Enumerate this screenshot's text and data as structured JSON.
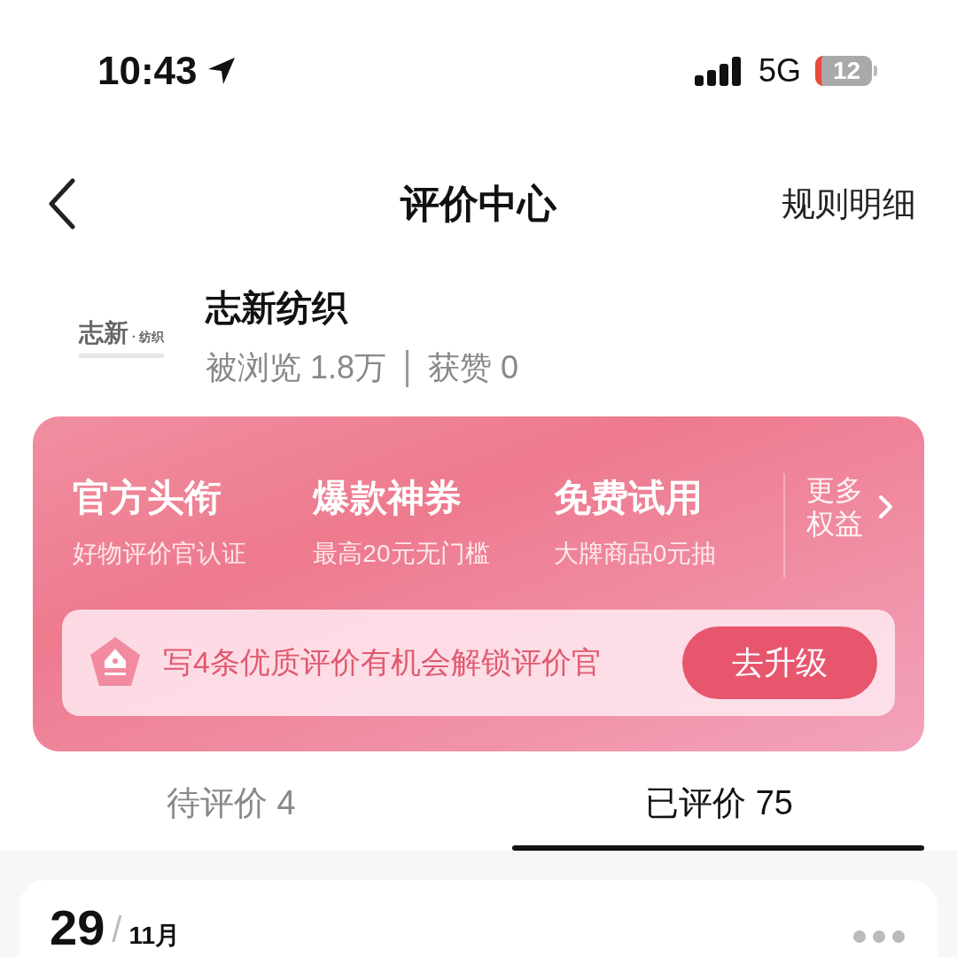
{
  "status_bar": {
    "time": "10:43",
    "network": "5G",
    "battery": "12"
  },
  "nav": {
    "title": "评价中心",
    "action": "规则明细"
  },
  "shop": {
    "logo": {
      "name": "志新",
      "suffix": "· 纺织"
    },
    "name": "志新纺织",
    "views": "被浏览 1.8万",
    "likes": "获赞 0"
  },
  "benefits": [
    {
      "title": "官方头衔",
      "subtitle": "好物评价官认证"
    },
    {
      "title": "爆款神券",
      "subtitle": "最高20元无门槛"
    },
    {
      "title": "免费试用",
      "subtitle": "大牌商品0元抽"
    }
  ],
  "more": "更多权益",
  "upgrade": {
    "text": "写4条优质评价有机会解锁评价官",
    "button": "去升级"
  },
  "tabs": [
    {
      "label": "待评价 4",
      "selected": false
    },
    {
      "label": "已评价 75",
      "selected": true
    }
  ],
  "record": {
    "day": "29",
    "separator": "/",
    "month": "11月"
  }
}
